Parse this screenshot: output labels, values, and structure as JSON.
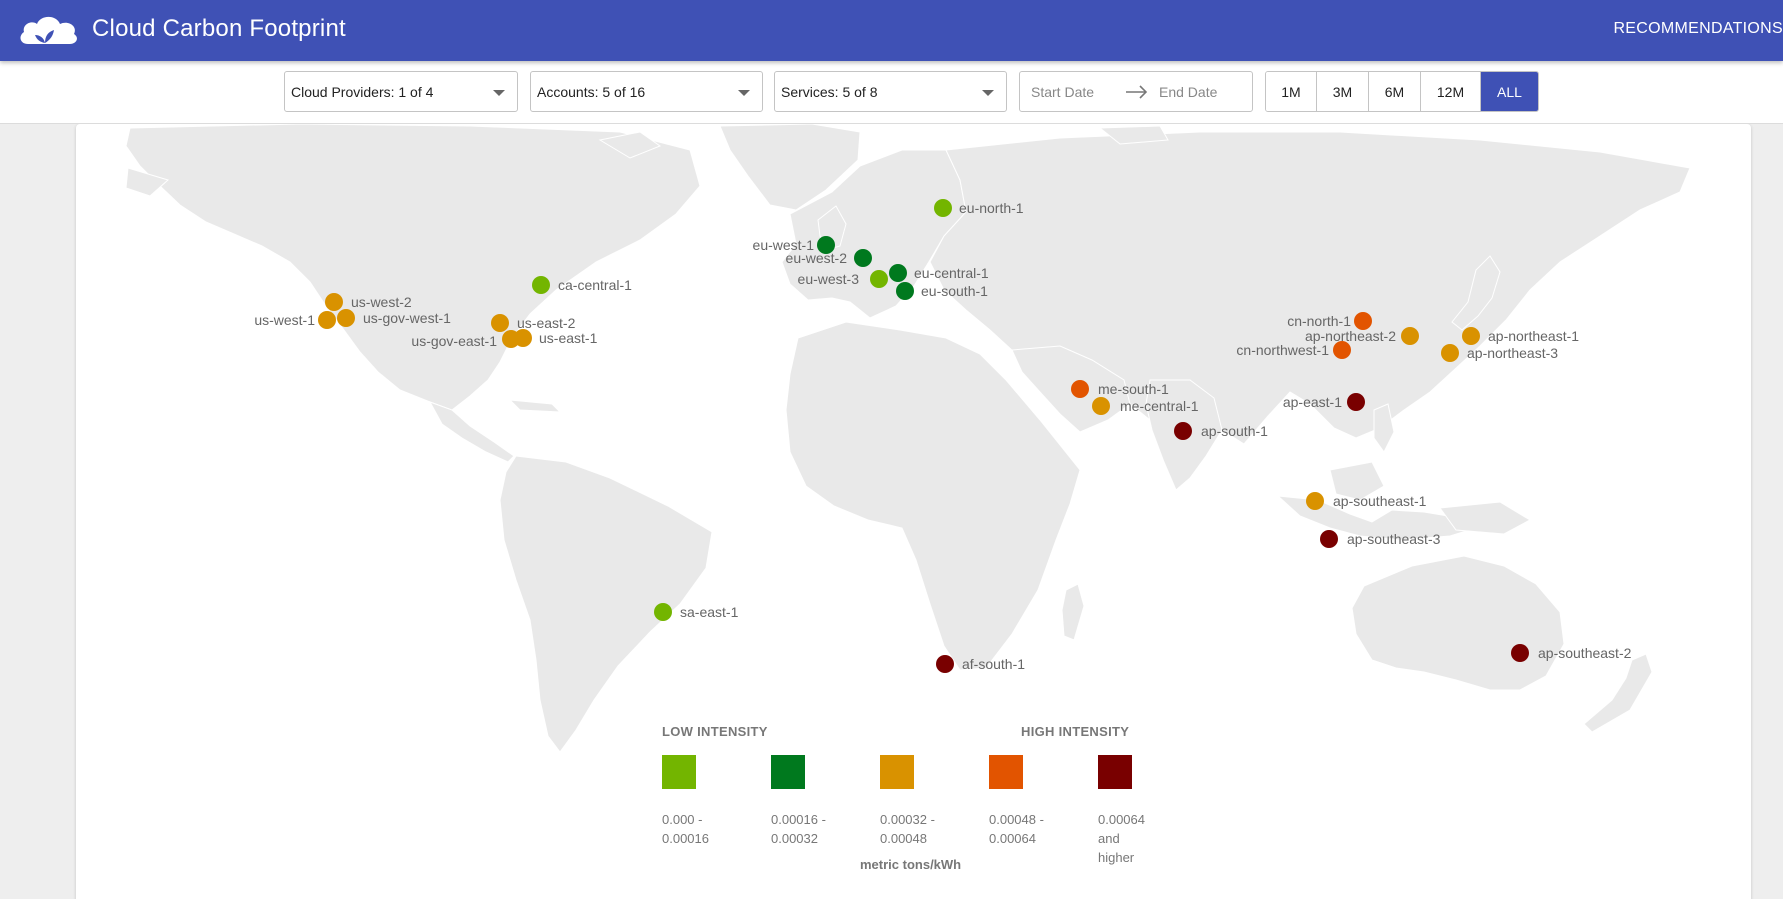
{
  "app": {
    "title": "Cloud Carbon Footprint",
    "recommendations_label": "RECOMMENDATIONS",
    "logo_icon": "cloud-leaf-icon"
  },
  "filters": {
    "cloud_providers": "Cloud Providers: 1 of 4",
    "accounts": "Accounts: 5 of 16",
    "services": "Services: 5 of 8",
    "start_date_placeholder": "Start Date",
    "end_date_placeholder": "End Date",
    "ranges": [
      {
        "label": "1M",
        "active": false
      },
      {
        "label": "3M",
        "active": false
      },
      {
        "label": "6M",
        "active": false
      },
      {
        "label": "12M",
        "active": false
      },
      {
        "label": "ALL",
        "active": true
      }
    ]
  },
  "colors": {
    "accent": "#3f51b5",
    "land": "#e9e9e9",
    "level0": "#73b500",
    "level1": "#00791e",
    "level2": "#d99200",
    "level3": "#e25400",
    "level4": "#790000"
  },
  "map": {
    "regions": [
      {
        "name": "eu-north-1",
        "level": 0
      },
      {
        "name": "eu-west-1",
        "level": 1
      },
      {
        "name": "eu-west-2",
        "level": 1
      },
      {
        "name": "eu-central-1",
        "level": 1
      },
      {
        "name": "eu-west-3",
        "level": 0
      },
      {
        "name": "eu-south-1",
        "level": 1
      },
      {
        "name": "ca-central-1",
        "level": 0
      },
      {
        "name": "us-west-2",
        "level": 2
      },
      {
        "name": "us-gov-west-1",
        "level": 2
      },
      {
        "name": "us-west-1",
        "level": 2
      },
      {
        "name": "us-east-2",
        "level": 2
      },
      {
        "name": "us-gov-east-1",
        "level": 2
      },
      {
        "name": "us-east-1",
        "level": 2
      },
      {
        "name": "cn-north-1",
        "level": 3
      },
      {
        "name": "ap-northeast-2",
        "level": 2
      },
      {
        "name": "ap-northeast-1",
        "level": 2
      },
      {
        "name": "cn-northwest-1",
        "level": 3
      },
      {
        "name": "ap-northeast-3",
        "level": 2
      },
      {
        "name": "me-south-1",
        "level": 3
      },
      {
        "name": "me-central-1",
        "level": 2
      },
      {
        "name": "ap-east-1",
        "level": 4
      },
      {
        "name": "ap-south-1",
        "level": 4
      },
      {
        "name": "ap-southeast-1",
        "level": 2
      },
      {
        "name": "ap-southeast-3",
        "level": 4
      },
      {
        "name": "sa-east-1",
        "level": 0
      },
      {
        "name": "af-south-1",
        "level": 4
      },
      {
        "name": "ap-southeast-2",
        "level": 4
      }
    ]
  },
  "legend": {
    "low_label": "LOW INTENSITY",
    "high_label": "HIGH INTENSITY",
    "unit": "metric tons/kWh",
    "bins": [
      {
        "range": "0.000 -\n0.00016",
        "color": "#73b500"
      },
      {
        "range": "0.00016 -\n0.00032",
        "color": "#00791e"
      },
      {
        "range": "0.00032 -\n0.00048",
        "color": "#d99200"
      },
      {
        "range": "0.00048 -\n0.00064",
        "color": "#e25400"
      },
      {
        "range": "0.00064\nand\nhigher",
        "color": "#790000"
      }
    ]
  }
}
